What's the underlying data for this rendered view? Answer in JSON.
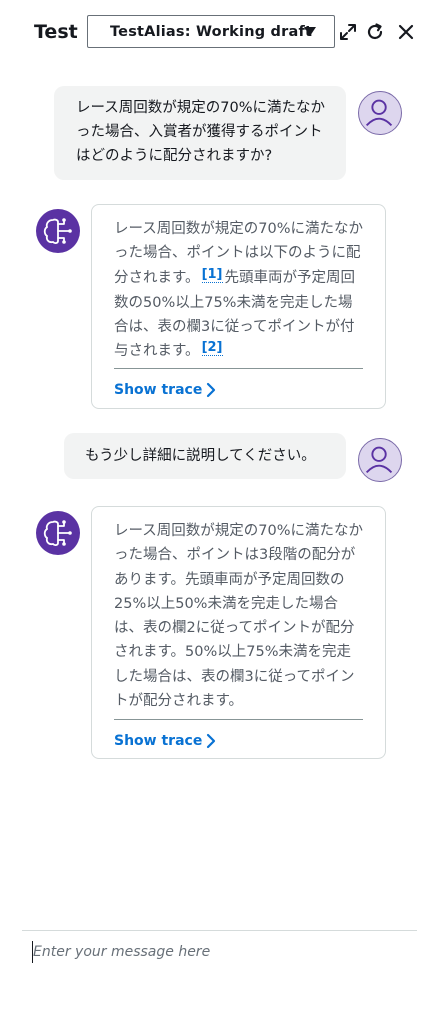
{
  "header": {
    "title": "Test",
    "alias_selected": "TestAlias: Working draft"
  },
  "conversation": [
    {
      "role": "user",
      "text": "レース周回数が規定の70%に満たなかった場合、入賞者が獲得するポイントはどのように配分されますか?"
    },
    {
      "role": "assistant",
      "text_part1": "レース周回数が規定の70%に満たなかった場合、ポイントは以下のように配分されます。",
      "citation1": "[1]",
      "text_part2": "先頭車両が予定周回数の50%以上75%未満を完走した場合は、表の欄3に従ってポイントが付与されます。",
      "citation2": "[2]",
      "trace_label": "Show trace"
    },
    {
      "role": "user",
      "text": "もう少し詳細に説明してください。"
    },
    {
      "role": "assistant",
      "text": "レース周回数が規定の70%に満たなかった場合、ポイントは3段階の配分があります。先頭車両が予定周回数の25%以上50%未満を完走した場合は、表の欄2に従ってポイントが配分されます。50%以上75%未満を完走した場合は、表の欄3に従ってポイントが配分されます。",
      "trace_label": "Show trace"
    }
  ],
  "input": {
    "placeholder": "Enter your message here",
    "value": ""
  },
  "colors": {
    "accent_link": "#0972d3",
    "bot_avatar": "#5a32a3",
    "user_avatar_bg": "#ddd6ee"
  }
}
